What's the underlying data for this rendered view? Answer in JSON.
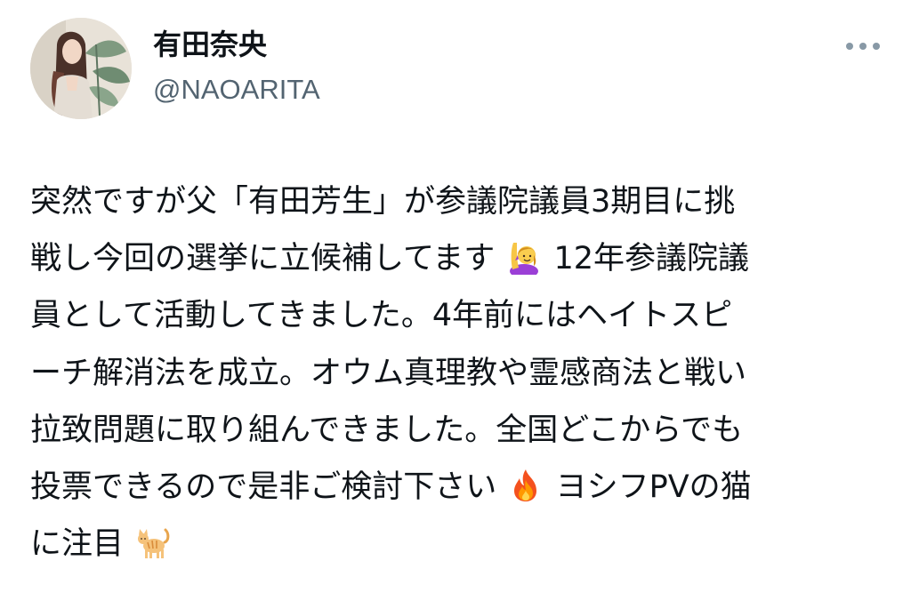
{
  "tweet": {
    "author": {
      "display_name": "有田奈央",
      "handle": "@NAOARITA",
      "avatar_icon": "profile-photo"
    },
    "more_icon": "more-dots-icon",
    "body": {
      "lines": [
        {
          "segments": [
            {
              "text": "突然ですが父「有田芳生」が参議院議員3期目に挑"
            }
          ]
        },
        {
          "segments": [
            {
              "text": "戦し今回の選挙に立候補してます"
            },
            {
              "emoji": "raising-hand-emoji"
            },
            {
              "text": "12年参議院議"
            }
          ]
        },
        {
          "segments": [
            {
              "text": "員として活動してきました。4年前にはヘイトスピ"
            }
          ]
        },
        {
          "segments": [
            {
              "text": "ーチ解消法を成立。オウム真理教や霊感商法と戦い"
            }
          ]
        },
        {
          "segments": [
            {
              "text": "拉致問題に取り組んできました。全国どこからでも"
            }
          ]
        },
        {
          "segments": [
            {
              "text": "投票できるので是非ご検討下さい"
            },
            {
              "emoji": "fire-emoji"
            },
            {
              "text": "ヨシフPVの猫"
            }
          ]
        },
        {
          "segments": [
            {
              "text": "に注目"
            },
            {
              "emoji": "cat-emoji"
            }
          ]
        }
      ]
    }
  },
  "colors": {
    "text": "#0f1419",
    "secondary_text": "#536471",
    "more_icon": "#8899a6",
    "background": "#ffffff"
  }
}
